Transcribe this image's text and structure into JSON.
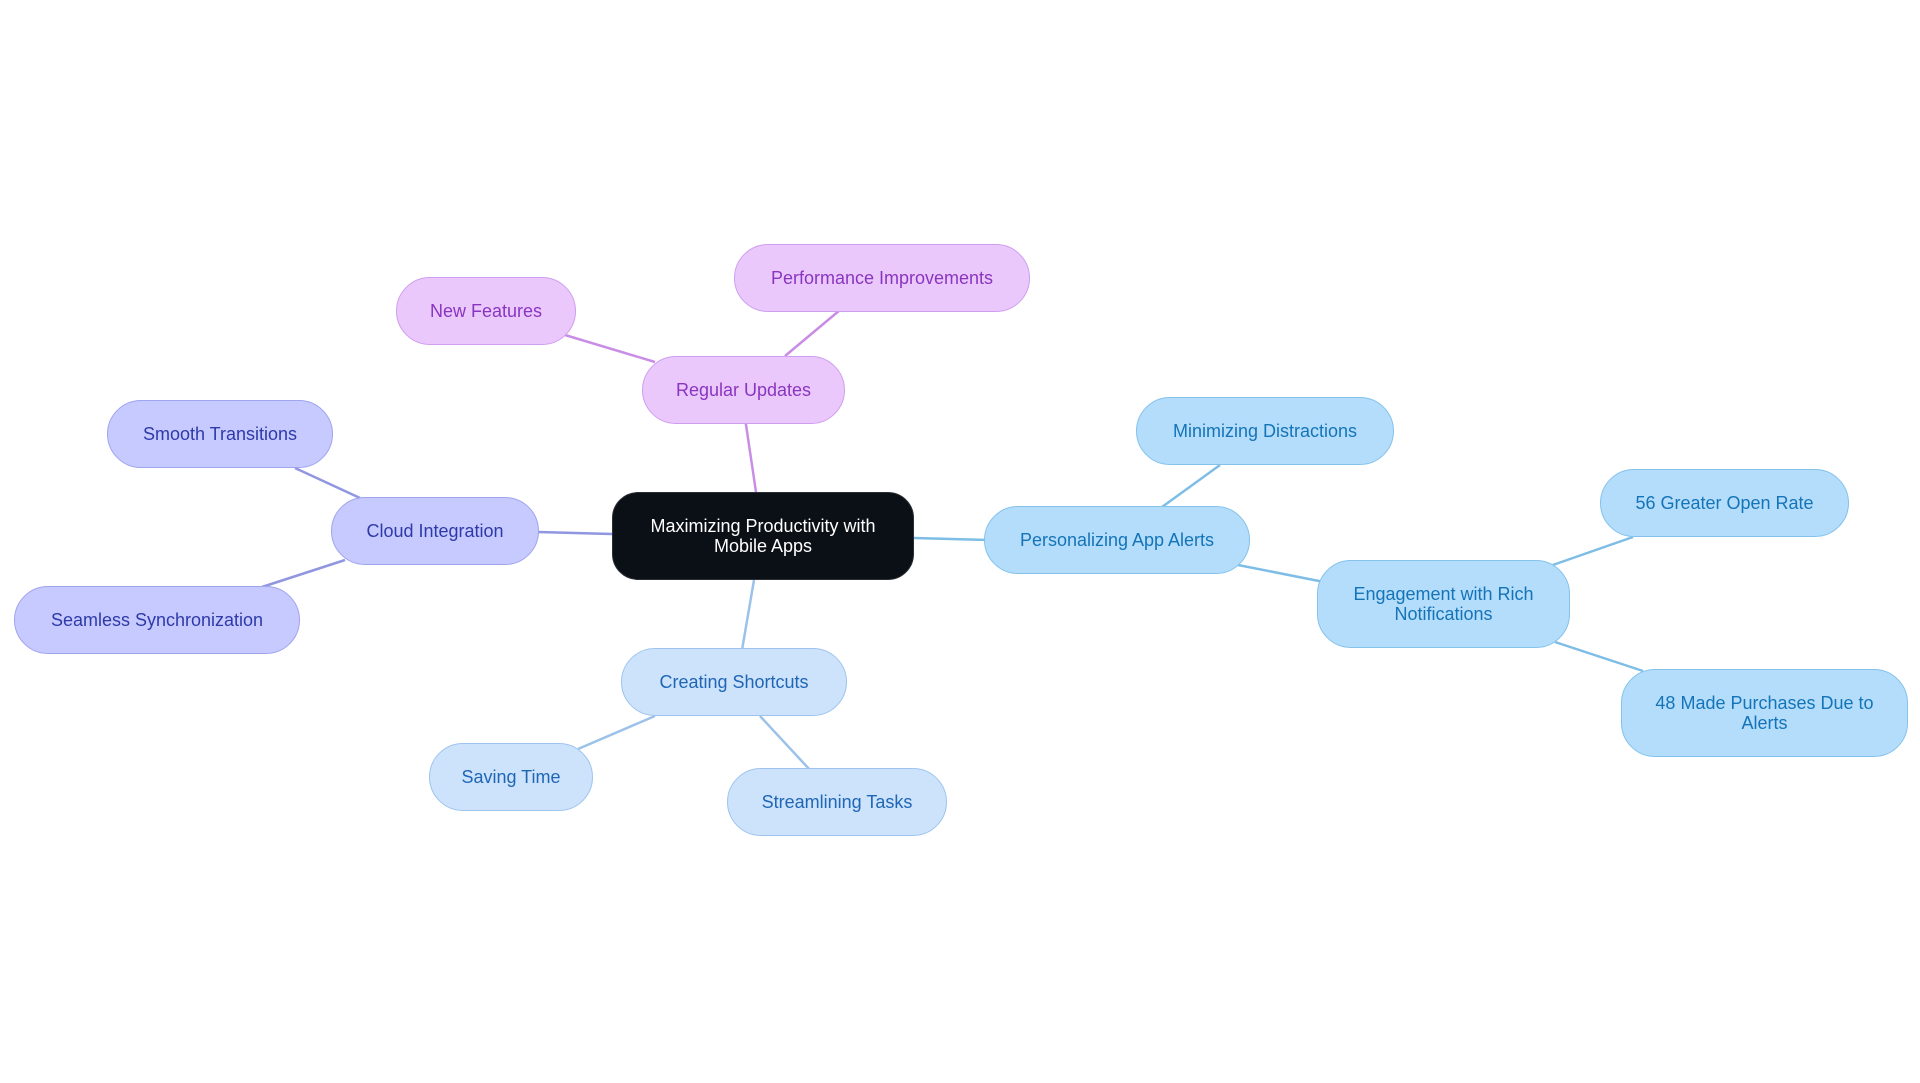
{
  "diagram": {
    "type": "mind-map",
    "root": {
      "id": "root",
      "label": "Maximizing Productivity with Mobile Apps"
    },
    "branch_colors": {
      "regular_updates": {
        "fill": "#eac8fc",
        "text": "#8a35c0",
        "edge": "#c98de6"
      },
      "cloud_integration": {
        "fill": "#c7caff",
        "text": "#2e3aa8",
        "edge": "#9096e0"
      },
      "personalizing_alerts": {
        "fill": "#b3ddfb",
        "text": "#1574b8",
        "edge": "#7dbde6"
      },
      "creating_shortcuts": {
        "fill": "#cde3fb",
        "text": "#1f66b5",
        "edge": "#9cc2ea"
      },
      "root": {
        "fill": "#0b1017",
        "text": "#ffffff"
      }
    },
    "nodes": [
      {
        "id": "regular_updates",
        "label": "Regular Updates",
        "parent": "root"
      },
      {
        "id": "new_features",
        "label": "New Features",
        "parent": "regular_updates"
      },
      {
        "id": "performance_improvements",
        "label": "Performance Improvements",
        "parent": "regular_updates"
      },
      {
        "id": "cloud_integration",
        "label": "Cloud Integration",
        "parent": "root"
      },
      {
        "id": "smooth_transitions",
        "label": "Smooth Transitions",
        "parent": "cloud_integration"
      },
      {
        "id": "seamless_sync",
        "label": "Seamless Synchronization",
        "parent": "cloud_integration"
      },
      {
        "id": "personalizing_alerts",
        "label": "Personalizing App Alerts",
        "parent": "root"
      },
      {
        "id": "minimizing_distractions",
        "label": "Minimizing Distractions",
        "parent": "personalizing_alerts"
      },
      {
        "id": "rich_notifications",
        "label": "Engagement with Rich Notifications",
        "parent": "personalizing_alerts"
      },
      {
        "id": "open_rate",
        "label": "56 Greater Open Rate",
        "parent": "rich_notifications"
      },
      {
        "id": "purchases",
        "label": "48 Made Purchases Due to Alerts",
        "parent": "rich_notifications"
      },
      {
        "id": "creating_shortcuts",
        "label": "Creating Shortcuts",
        "parent": "root"
      },
      {
        "id": "saving_time",
        "label": "Saving Time",
        "parent": "creating_shortcuts"
      },
      {
        "id": "streamlining_tasks",
        "label": "Streamlining Tasks",
        "parent": "creating_shortcuts"
      }
    ]
  }
}
